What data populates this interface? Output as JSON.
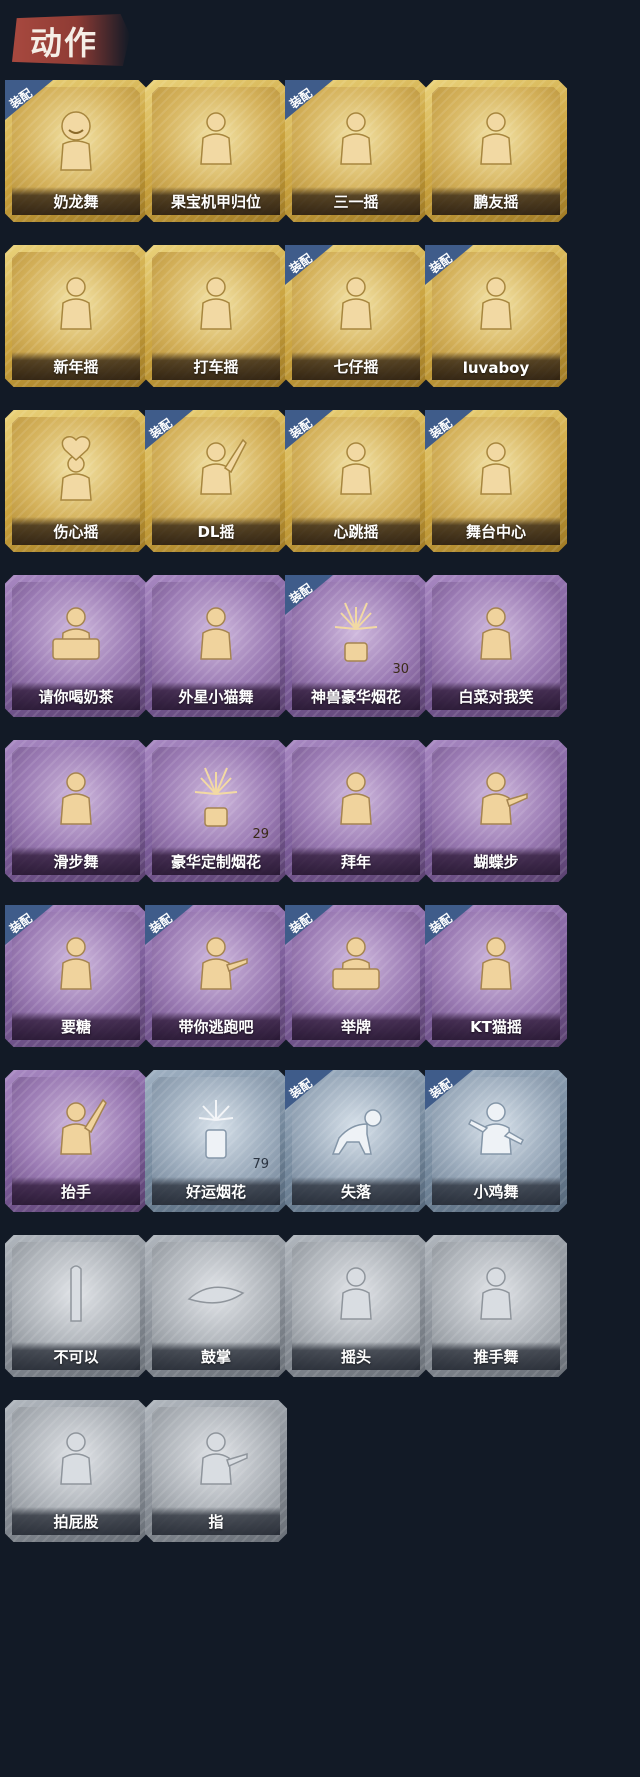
{
  "header": {
    "title": "动作"
  },
  "equip_label": "装配",
  "cards": [
    {
      "label": "奶龙舞",
      "tier": "gold",
      "equipped": true,
      "icon": "dance-smile-icon"
    },
    {
      "label": "果宝机甲归位",
      "tier": "gold",
      "equipped": false,
      "icon": "pose-icon"
    },
    {
      "label": "三一摇",
      "tier": "gold",
      "equipped": true,
      "icon": "shake-icon"
    },
    {
      "label": "鹏友摇",
      "tier": "gold",
      "equipped": false,
      "icon": "shake-icon"
    },
    {
      "label": "新年摇",
      "tier": "gold",
      "equipped": false,
      "icon": "shake-icon"
    },
    {
      "label": "打车摇",
      "tier": "gold",
      "equipped": false,
      "icon": "shake-icon"
    },
    {
      "label": "七仔摇",
      "tier": "gold",
      "equipped": true,
      "icon": "shake-icon"
    },
    {
      "label": "luvaboy",
      "tier": "gold",
      "equipped": true,
      "icon": "shake-icon"
    },
    {
      "label": "伤心摇",
      "tier": "gold",
      "equipped": false,
      "icon": "heart-hands-icon"
    },
    {
      "label": "DL摇",
      "tier": "gold",
      "equipped": true,
      "icon": "raise-arm-icon"
    },
    {
      "label": "心跳摇",
      "tier": "gold",
      "equipped": true,
      "icon": "wave-icon"
    },
    {
      "label": "舞台中心",
      "tier": "gold",
      "equipped": true,
      "icon": "dance-icon"
    },
    {
      "label": "请你喝奶茶",
      "tier": "purple",
      "equipped": false,
      "icon": "sign-icon"
    },
    {
      "label": "外星小猫舞",
      "tier": "purple",
      "equipped": false,
      "icon": "dance-icon"
    },
    {
      "label": "神兽豪华烟花",
      "tier": "purple",
      "equipped": true,
      "icon": "fireworks-icon",
      "count": "30"
    },
    {
      "label": "白菜对我笑",
      "tier": "purple",
      "equipped": false,
      "icon": "dance-icon"
    },
    {
      "label": "滑步舞",
      "tier": "purple",
      "equipped": false,
      "icon": "dance-icon"
    },
    {
      "label": "豪华定制烟花",
      "tier": "purple",
      "equipped": false,
      "icon": "fireworks-icon",
      "count": "29"
    },
    {
      "label": "拜年",
      "tier": "purple",
      "equipped": false,
      "icon": "bow-icon"
    },
    {
      "label": "蝴蝶步",
      "tier": "purple",
      "equipped": false,
      "icon": "point-icon"
    },
    {
      "label": "要糖",
      "tier": "purple",
      "equipped": true,
      "icon": "reach-icon"
    },
    {
      "label": "带你逃跑吧",
      "tier": "purple",
      "equipped": true,
      "icon": "point-icon"
    },
    {
      "label": "举牌",
      "tier": "purple",
      "equipped": true,
      "icon": "sign-icon"
    },
    {
      "label": "KT猫摇",
      "tier": "purple",
      "equipped": true,
      "icon": "shake-icon"
    },
    {
      "label": "抬手",
      "tier": "purple",
      "equipped": false,
      "icon": "raise-arm-icon"
    },
    {
      "label": "好运烟花",
      "tier": "blue",
      "equipped": false,
      "icon": "firework-can-icon",
      "count": "79"
    },
    {
      "label": "失落",
      "tier": "blue",
      "equipped": true,
      "icon": "crawl-icon"
    },
    {
      "label": "小鸡舞",
      "tier": "blue",
      "equipped": true,
      "icon": "chicken-dance-icon"
    },
    {
      "label": "不可以",
      "tier": "gray",
      "equipped": false,
      "icon": "finger-no-icon"
    },
    {
      "label": "鼓掌",
      "tier": "gray",
      "equipped": false,
      "icon": "clap-icon"
    },
    {
      "label": "摇头",
      "tier": "gray",
      "equipped": false,
      "icon": "head-shake-icon"
    },
    {
      "label": "推手舞",
      "tier": "gray",
      "equipped": false,
      "icon": "push-hands-icon"
    },
    {
      "label": "拍屁股",
      "tier": "gray",
      "equipped": false,
      "icon": "slap-icon"
    },
    {
      "label": "指",
      "tier": "gray",
      "equipped": false,
      "icon": "point-hand-icon"
    }
  ]
}
